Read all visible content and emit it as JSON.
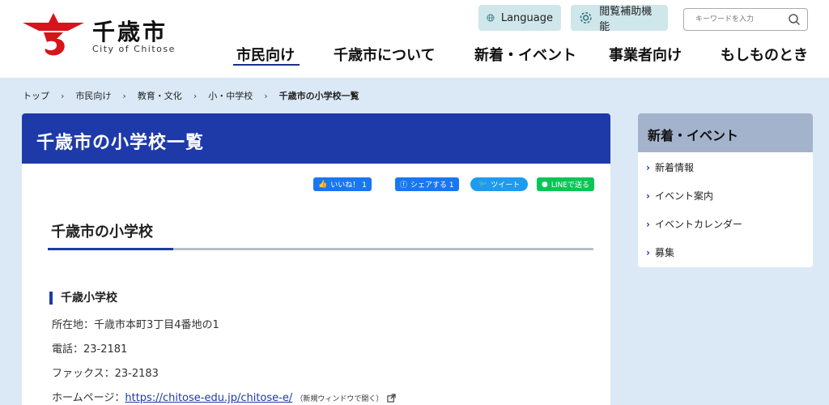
{
  "header": {
    "logo_title": "千歳市",
    "logo_sub": "City of Chitose",
    "language_label": "Language",
    "accessibility_label": "閲覧補助機能",
    "search_placeholder": "キーワードを入力",
    "nav": [
      "市民向け",
      "千歳市について",
      "新着・イベント",
      "事業者向け",
      "もしものとき"
    ],
    "brand_red": "#d7141a",
    "nav_active_color": "#1a2f8a"
  },
  "breadcrumb": {
    "items": [
      "トップ",
      "市民向け",
      "教育・文化",
      "小・中学校"
    ],
    "current": "千歳市の小学校一覧",
    "separator": "›"
  },
  "main": {
    "title": "千歳市の小学校一覧",
    "share": {
      "like": "いいね！ 1",
      "share": "シェアする 1",
      "tweet": "ツイート",
      "line": "LINEで送る"
    },
    "section_title": "千歳市の小学校",
    "school": {
      "name": "千歳小学校",
      "address": "所在地：千歳市本町3丁目4番地の1",
      "phone": "電話：23-2181",
      "fax": "ファックス：23-2183",
      "homepage_label": "ホームページ：",
      "homepage_url": "https://chitose-edu.jp/chitose-e/",
      "new_window_note": "（新規ウィンドウで開く）"
    }
  },
  "side": {
    "title": "新着・イベント",
    "items": [
      "新着情報",
      "イベント案内",
      "イベントカレンダー",
      "募集"
    ]
  }
}
